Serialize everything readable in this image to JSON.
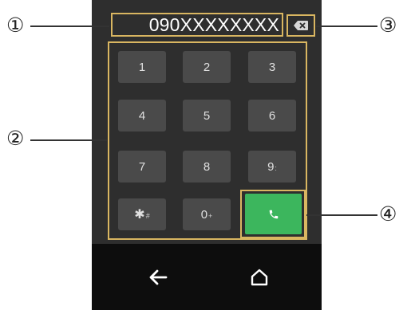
{
  "dialer": {
    "number": "090XXXXXXXX",
    "keys": [
      {
        "main": "1",
        "sub": ""
      },
      {
        "main": "2",
        "sub": ""
      },
      {
        "main": "3",
        "sub": ""
      },
      {
        "main": "4",
        "sub": ""
      },
      {
        "main": "5",
        "sub": ""
      },
      {
        "main": "6",
        "sub": ""
      },
      {
        "main": "7",
        "sub": ""
      },
      {
        "main": "8",
        "sub": ""
      },
      {
        "main": "9",
        "sub": ":"
      },
      {
        "main": "✱",
        "sub": "#"
      },
      {
        "main": "0",
        "sub": "+"
      }
    ],
    "call_icon": "phone-icon",
    "backspace_icon": "backspace-icon"
  },
  "nav": {
    "back_icon": "back-arrow-icon",
    "home_icon": "home-icon"
  },
  "callouts": [
    "①",
    "②",
    "③",
    "④"
  ],
  "colors": {
    "highlight": "#d9b661",
    "call": "#3cb65d",
    "screen": "#2e2e2e",
    "key": "#4a4a4a",
    "navbar": "#0d0d0d"
  }
}
